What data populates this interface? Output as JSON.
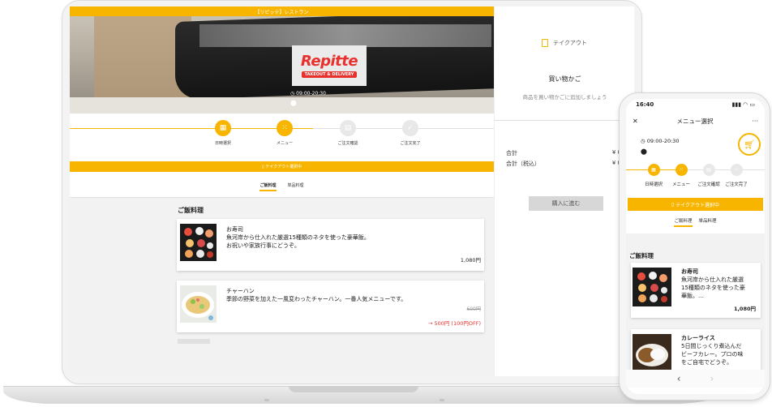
{
  "laptop": {
    "top_strip": "【リピッテ】レストラン",
    "logo": {
      "text": "Repitte",
      "sub": "TAKEOUT & DELIVERY"
    },
    "hours": "09:00-20:30",
    "steps": [
      {
        "label": "日時選択",
        "state": "done"
      },
      {
        "label": "メニュー",
        "state": "current"
      },
      {
        "label": "ご注文確認",
        "state": "todo"
      },
      {
        "label": "ご注文完了",
        "state": "todo"
      }
    ],
    "takeout_bar": "テイクアウト選択中",
    "tabs": [
      {
        "label": "ご飯料理",
        "active": true
      },
      {
        "label": "単品料理",
        "active": false
      }
    ],
    "section_title": "ご飯料理",
    "items": [
      {
        "name": "お寿司",
        "desc_line1": "魚河岸から仕入れた厳選15種類のネタを使った豪華飯。",
        "desc_line2": "お祝いや家族行事にどうぞ。",
        "price": "1,080円"
      },
      {
        "name": "チャーハン",
        "desc_line1": "季節の野菜を加えた一風変わったチャーハン。一番人気メニューです。",
        "old_price": "600円",
        "sale_price": "→ 500円 (100円OFF)"
      }
    ],
    "cart": {
      "takeout_label": "テイクアウト",
      "title": "買い物かご",
      "empty_message": "商品を買い物かごに追加しましょう",
      "subtotal_label": "合計",
      "subtotal_value": "¥ 0",
      "total_label": "合計（税込）",
      "total_value": "¥ 0",
      "checkout_label": "購入に進む"
    }
  },
  "phone": {
    "status_time": "16:40",
    "status_icons": "▮▮▮ ◠ ▭",
    "header_title": "メニュー選択",
    "close_icon": "✕",
    "more_icon": "···",
    "hours": "09:00-20:30",
    "steps": [
      {
        "label": "日時選択",
        "state": "done"
      },
      {
        "label": "メニュー",
        "state": "current"
      },
      {
        "label": "ご注文確認",
        "state": "todo"
      },
      {
        "label": "ご注文完了",
        "state": "todo"
      }
    ],
    "takeout_bar": "テイクアウト選択中",
    "tabs": [
      {
        "label": "ご飯料理",
        "active": true
      },
      {
        "label": "単品料理",
        "active": false
      }
    ],
    "section_title": "ご飯料理",
    "items": [
      {
        "name": "お寿司",
        "desc_line1": "魚河岸から仕入れた厳選",
        "desc_line2": "15種類のネタを使った豪",
        "desc_line3": "華飯。…",
        "price": "1,080円"
      },
      {
        "name": "カレーライス",
        "desc_line1": "5日間じっくり煮込んだ",
        "desc_line2": "ビーフカレー。プロの味",
        "desc_line3": "をご自宅でどうぞ。"
      }
    ],
    "nav_back": "‹",
    "nav_forward": "›"
  },
  "colors": {
    "accent": "#f7b500",
    "logo_red": "#e8302c",
    "sale_red": "#e8302c"
  }
}
